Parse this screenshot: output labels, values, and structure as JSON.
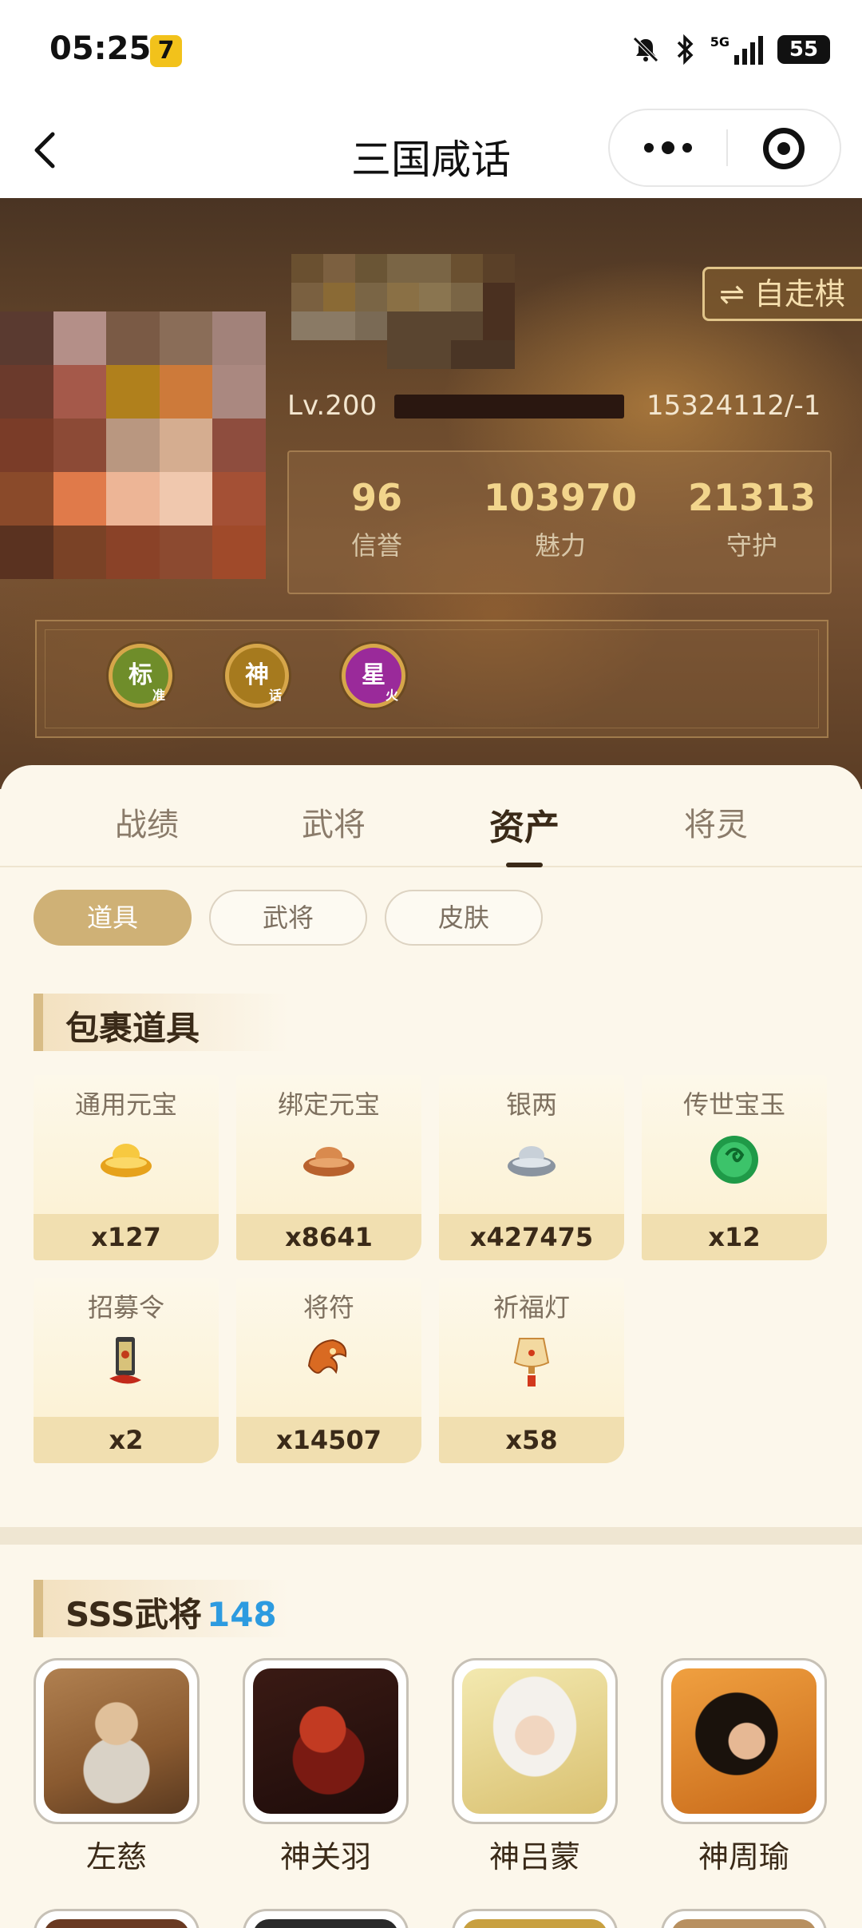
{
  "status_bar": {
    "time": "05:25",
    "app_icon_glyph": "7",
    "network": "5G",
    "battery": "55"
  },
  "nav": {
    "title": "三国咸话"
  },
  "profile": {
    "mode_button": "⇌ 自走棋",
    "level": "Lv.200",
    "uid": "15324112/-1",
    "stats": [
      {
        "value": "96",
        "label": "信誉"
      },
      {
        "value": "103970",
        "label": "魅力"
      },
      {
        "value": "21313",
        "label": "守护"
      }
    ],
    "badges": [
      {
        "main": "标",
        "sub": "准",
        "color": "#6f8d2a"
      },
      {
        "main": "神",
        "sub": "话",
        "color": "#a67a1e"
      },
      {
        "main": "星",
        "sub": "火",
        "color": "#9a2a9a"
      }
    ]
  },
  "tabs": [
    {
      "label": "战绩",
      "active": false
    },
    {
      "label": "武将",
      "active": false
    },
    {
      "label": "资产",
      "active": true
    },
    {
      "label": "将灵",
      "active": false
    }
  ],
  "filters": [
    {
      "label": "道具",
      "active": true
    },
    {
      "label": "武将",
      "active": false
    },
    {
      "label": "皮肤",
      "active": false
    }
  ],
  "bag": {
    "title": "包裹道具",
    "items": [
      {
        "name": "通用元宝",
        "qty": "x127",
        "icon": "gold-ingot-icon"
      },
      {
        "name": "绑定元宝",
        "qty": "x8641",
        "icon": "bronze-ingot-icon"
      },
      {
        "name": "银两",
        "qty": "x427475",
        "icon": "silver-ingot-icon"
      },
      {
        "name": "传世宝玉",
        "qty": "x12",
        "icon": "jade-icon"
      },
      {
        "name": "招募令",
        "qty": "x2",
        "icon": "recruit-token-icon"
      },
      {
        "name": "将符",
        "qty": "x14507",
        "icon": "general-talisman-icon"
      },
      {
        "name": "祈福灯",
        "qty": "x58",
        "icon": "lantern-icon"
      }
    ]
  },
  "generals": {
    "title": "SSS武将",
    "count": "148",
    "list": [
      {
        "name": "左慈"
      },
      {
        "name": "神关羽"
      },
      {
        "name": "神吕蒙"
      },
      {
        "name": "神周瑜"
      }
    ]
  },
  "colors": {
    "accent_gold": "#cfb176",
    "count_blue": "#2d9be0",
    "text_dark": "#3a2a18"
  }
}
